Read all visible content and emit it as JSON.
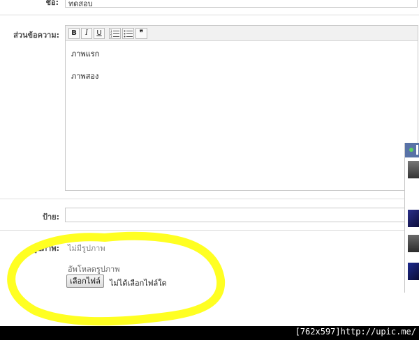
{
  "form": {
    "title_label": "ชื่อ:",
    "title_value": "ทดสอบ",
    "message_label": "ส่วนข้อความ:",
    "tag_label": "ป้าย:",
    "picture_label": "รูปภาพ:",
    "no_picture": "ไม่มีรูปภาพ",
    "upload_label": "อัพโหลดรูปภาพ",
    "choose_file": "เลือกไฟล์",
    "no_file_chosen": "ไม่ได้เลือกไฟล์ใด"
  },
  "editor": {
    "toolbar": {
      "bold": "B",
      "italic": "I",
      "underline": "U",
      "numbered_list_icon": "numbered-list-icon",
      "bullet_list_icon": "bullet-list-icon",
      "quote_glyph": "❞"
    },
    "lines": [
      "ภาพแรก",
      "ภาพสอง"
    ]
  },
  "colors": {
    "highlight": "#ffff22",
    "sidebar_header": "#5872a7"
  },
  "watermark": "[762x597]http://upic.me/"
}
